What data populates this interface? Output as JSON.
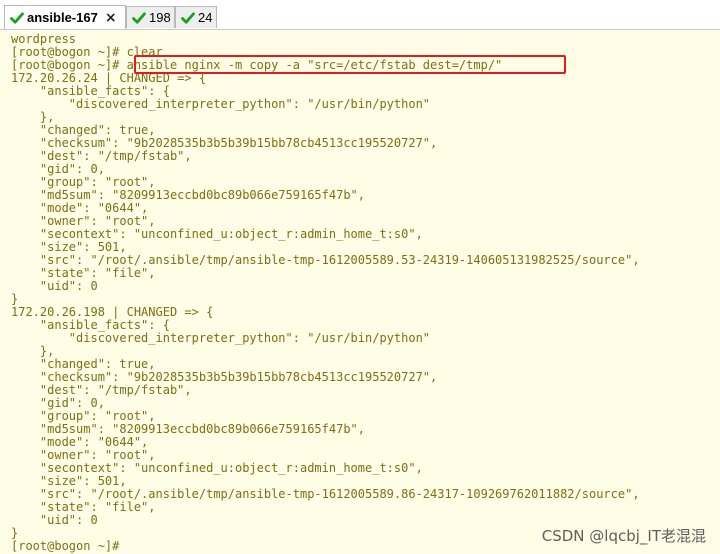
{
  "tabs": [
    {
      "label": "ansible-167",
      "close": "×",
      "active": true,
      "icon": "check-icon"
    },
    {
      "label": "198",
      "active": false,
      "icon": "check-icon"
    },
    {
      "label": "24",
      "active": false,
      "icon": "check-icon"
    }
  ],
  "colors": {
    "terminal_bg": "#fffde6",
    "terminal_text": "#7c7014",
    "highlight_border": "#e21c1c",
    "check_green": "#1aa21a"
  },
  "terminal": {
    "lines": [
      "wordpress",
      "[root@bogon ~]# clear",
      "[root@bogon ~]# ansible nginx -m copy -a \"src=/etc/fstab dest=/tmp/\"",
      "172.20.26.24 | CHANGED => {",
      "    \"ansible_facts\": {",
      "        \"discovered_interpreter_python\": \"/usr/bin/python\"",
      "    },",
      "    \"changed\": true,",
      "    \"checksum\": \"9b2028535b3b5b39b15bb78cb4513cc195520727\",",
      "    \"dest\": \"/tmp/fstab\",",
      "    \"gid\": 0,",
      "    \"group\": \"root\",",
      "    \"md5sum\": \"8209913eccbd0bc89b066e759165f47b\",",
      "    \"mode\": \"0644\",",
      "    \"owner\": \"root\",",
      "    \"secontext\": \"unconfined_u:object_r:admin_home_t:s0\",",
      "    \"size\": 501,",
      "    \"src\": \"/root/.ansible/tmp/ansible-tmp-1612005589.53-24319-140605131982525/source\",",
      "    \"state\": \"file\",",
      "    \"uid\": 0",
      "}",
      "172.20.26.198 | CHANGED => {",
      "    \"ansible_facts\": {",
      "        \"discovered_interpreter_python\": \"/usr/bin/python\"",
      "    },",
      "    \"changed\": true,",
      "    \"checksum\": \"9b2028535b3b5b39b15bb78cb4513cc195520727\",",
      "    \"dest\": \"/tmp/fstab\",",
      "    \"gid\": 0,",
      "    \"group\": \"root\",",
      "    \"md5sum\": \"8209913eccbd0bc89b066e759165f47b\",",
      "    \"mode\": \"0644\",",
      "    \"owner\": \"root\",",
      "    \"secontext\": \"unconfined_u:object_r:admin_home_t:s0\",",
      "    \"size\": 501,",
      "    \"src\": \"/root/.ansible/tmp/ansible-tmp-1612005589.86-24317-109269762011882/source\",",
      "    \"state\": \"file\",",
      "    \"uid\": 0",
      "}",
      "[root@bogon ~]# "
    ]
  },
  "watermark": "CSDN @lqcbj_IT老混混"
}
